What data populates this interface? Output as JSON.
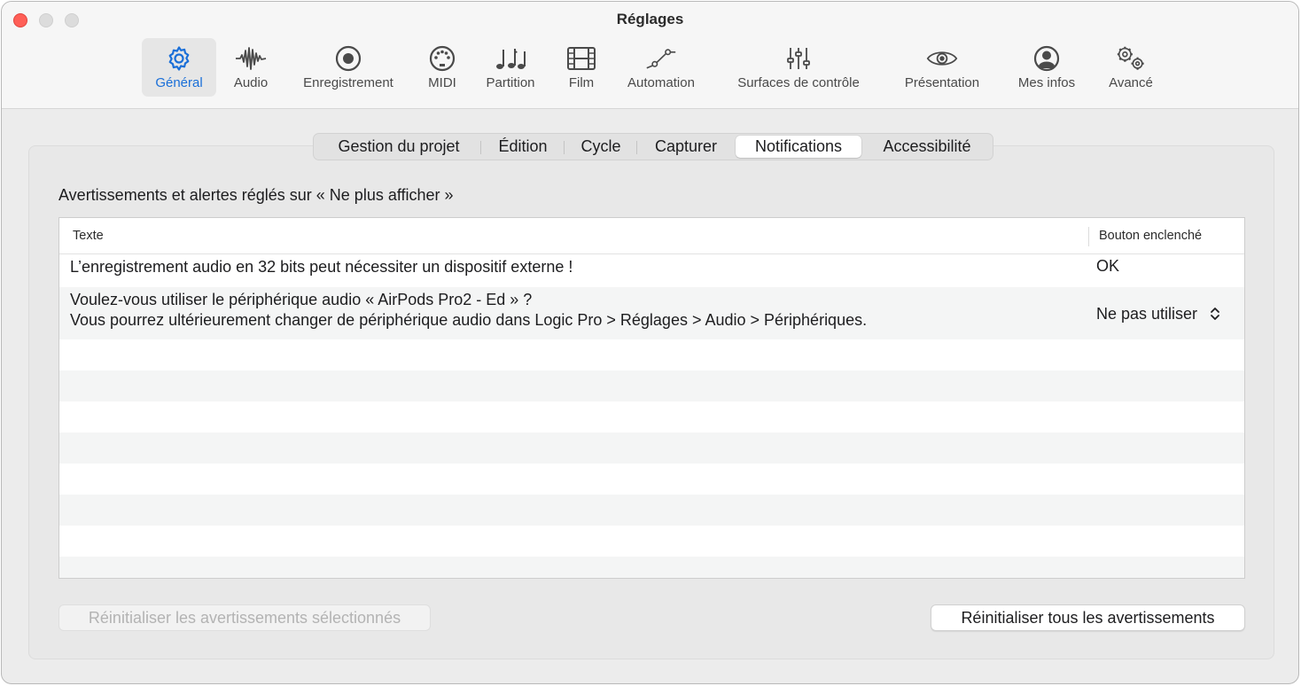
{
  "window": {
    "title": "Réglages"
  },
  "toolbar": {
    "items": [
      {
        "label": "Général",
        "icon": "gear-icon",
        "selected": true
      },
      {
        "label": "Audio",
        "icon": "waveform-icon"
      },
      {
        "label": "Enregistrement",
        "icon": "record-icon"
      },
      {
        "label": "MIDI",
        "icon": "midi-port-icon"
      },
      {
        "label": "Partition",
        "icon": "music-notes-icon"
      },
      {
        "label": "Film",
        "icon": "film-icon"
      },
      {
        "label": "Automation",
        "icon": "automation-curve-icon"
      },
      {
        "label": "Surfaces de contrôle",
        "icon": "sliders-icon"
      },
      {
        "label": "Présentation",
        "icon": "eye-icon"
      },
      {
        "label": "Mes infos",
        "icon": "person-icon"
      },
      {
        "label": "Avancé",
        "icon": "gears-icon"
      }
    ],
    "accent_color": "#1a6fd8"
  },
  "tabs": [
    {
      "label": "Gestion du projet"
    },
    {
      "label": "Édition"
    },
    {
      "label": "Cycle"
    },
    {
      "label": "Capturer"
    },
    {
      "label": "Notifications",
      "active": true
    },
    {
      "label": "Accessibilité"
    }
  ],
  "section": {
    "title": "Avertissements et alertes réglés sur « Ne plus afficher »"
  },
  "table": {
    "columns": [
      "Texte",
      "Bouton enclenché"
    ],
    "rows": [
      {
        "text_line1": "L’enregistrement audio en 32 bits peut nécessiter un dispositif externe !",
        "button": "OK"
      },
      {
        "text_line1": "Voulez-vous utiliser le périphérique audio « AirPods Pro2 - Ed » ?",
        "text_line2": "Vous pourrez ultérieurement changer de périphérique audio dans Logic Pro > Réglages > Audio > Périphériques.",
        "button": "Ne pas utiliser"
      }
    ]
  },
  "buttons": {
    "reset_selected": "Réinitialiser les avertissements sélectionnés",
    "reset_all": "Réinitialiser tous les avertissements"
  }
}
